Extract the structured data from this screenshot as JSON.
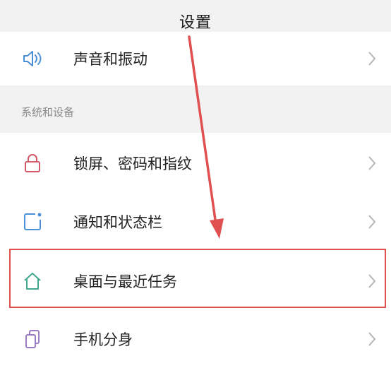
{
  "header": {
    "title": "设置"
  },
  "section_title": "系统和设备",
  "rows": [
    {
      "label": "声音和振动",
      "icon": "speaker-icon"
    },
    {
      "label": "锁屏、密码和指纹",
      "icon": "lock-icon"
    },
    {
      "label": "通知和状态栏",
      "icon": "notification-icon"
    },
    {
      "label": "桌面与最近任务",
      "icon": "home-icon",
      "highlighted": true
    },
    {
      "label": "手机分身",
      "icon": "dual-phone-icon"
    }
  ],
  "colors": {
    "icon_blue": "#4a90d9",
    "icon_red": "#d45a6a",
    "icon_teal": "#3fa88f",
    "icon_purple": "#9a7cc2",
    "annotation_red": "#e05050"
  }
}
